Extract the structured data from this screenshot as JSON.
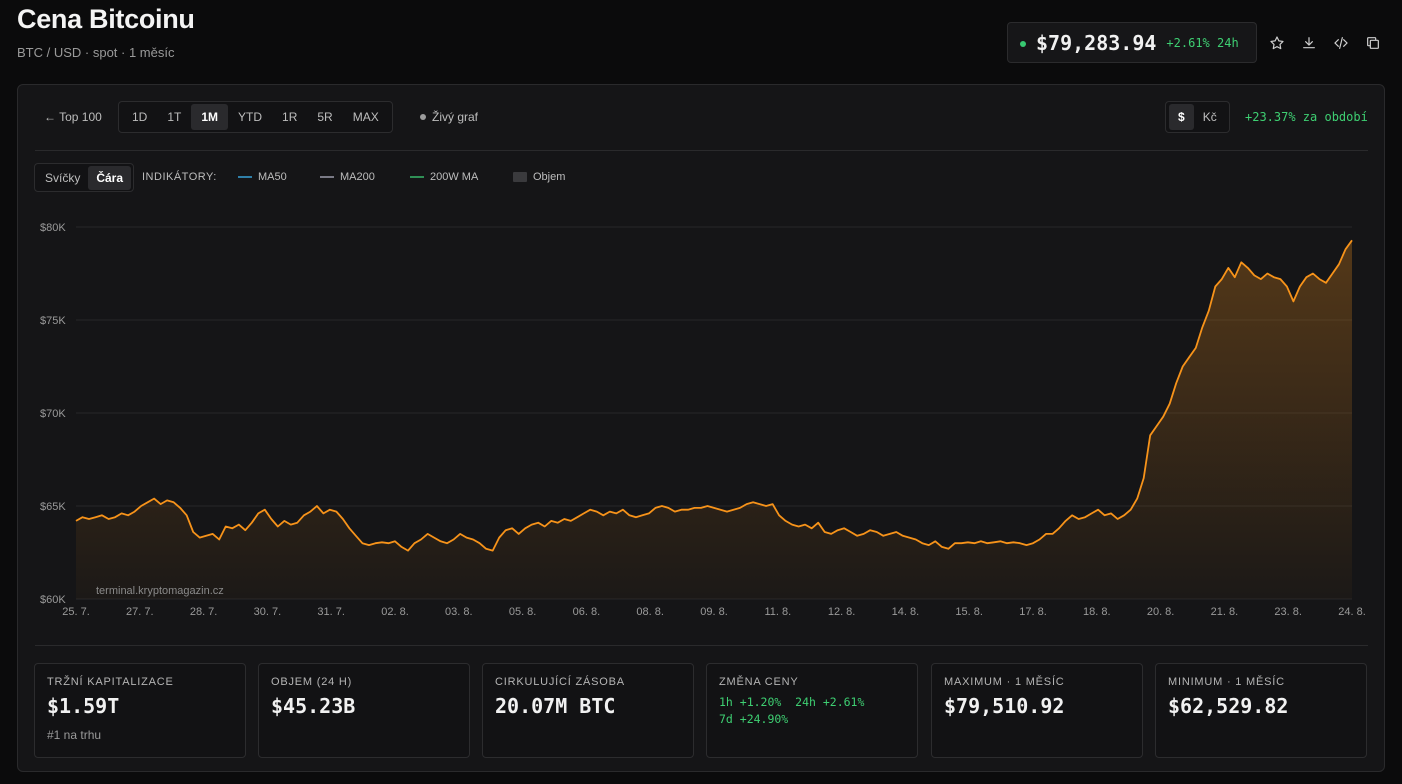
{
  "header": {
    "title": "Cena Bitcoinu",
    "subtitle": "BTC / USD · spot · 1 měsíc",
    "price": "$79,283.94",
    "price_change": "+2.61% 24h"
  },
  "toolbar": {
    "back_label": "← Top 100",
    "ranges": [
      "1D",
      "1T",
      "1M",
      "YTD",
      "1R",
      "5R",
      "MAX"
    ],
    "active_range": "1M",
    "live_chart_label": "Živý graf",
    "currencies": [
      "$",
      "Kč"
    ],
    "active_currency": "$",
    "period_change": "+23.37% za období"
  },
  "chart_controls": {
    "types": [
      "Svíčky",
      "Čára"
    ],
    "active_type": "Čára",
    "indicators_label": "INDIKÁTORY:",
    "indicators": [
      {
        "label": "MA50",
        "color": "#2f7fa8"
      },
      {
        "label": "MA200",
        "color": "#7a7a86"
      },
      {
        "label": "200W MA",
        "color": "#2f8f55"
      },
      {
        "label": "Objem",
        "color": "#3a3a3d"
      }
    ]
  },
  "chart_data": {
    "type": "area",
    "title": "",
    "xlabel": "",
    "ylabel": "",
    "ylim": [
      60000,
      80000
    ],
    "y_ticks": [
      "$80K",
      "$75K",
      "$70K",
      "$65K",
      "$60K"
    ],
    "x_ticks": [
      "25. 7.",
      "27. 7.",
      "28. 7.",
      "30. 7.",
      "31. 7.",
      "02. 8.",
      "03. 8.",
      "05. 8.",
      "06. 8.",
      "08. 8.",
      "09. 8.",
      "11. 8.",
      "12. 8.",
      "14. 8.",
      "15. 8.",
      "17. 8.",
      "18. 8.",
      "20. 8.",
      "21. 8.",
      "23. 8.",
      "24. 8."
    ],
    "line_color": "#f7931a",
    "grid": true,
    "watermark": "terminal.kryptomagazin.cz",
    "series": [
      {
        "values": [
          64200,
          64400,
          64300,
          64400,
          64500,
          64300,
          64400,
          64600,
          64500,
          64700,
          65000,
          65200,
          65400,
          65100,
          65300,
          65200,
          64900,
          64500,
          63600,
          63300,
          63400,
          63500,
          63200,
          63900,
          63800,
          64000,
          63700,
          64100,
          64600,
          64800,
          64300,
          63900,
          64200,
          64000,
          64100,
          64500,
          64700,
          65000,
          64600,
          64800,
          64700,
          64300,
          63800,
          63400,
          63000,
          62900,
          63000,
          63050,
          63000,
          63100,
          62800,
          62600,
          63000,
          63200,
          63500,
          63300,
          63100,
          63000,
          63200,
          63500,
          63300,
          63200,
          63000,
          62700,
          62600,
          63300,
          63700,
          63800,
          63500,
          63800,
          64000,
          64100,
          63900,
          64200,
          64100,
          64300,
          64200,
          64400,
          64600,
          64800,
          64700,
          64500,
          64700,
          64600,
          64800,
          64500,
          64400,
          64500,
          64600,
          64900,
          65000,
          64900,
          64700,
          64800,
          64800,
          64900,
          64900,
          65000,
          64900,
          64800,
          64700,
          64800,
          64900,
          65100,
          65200,
          65100,
          65000,
          65100,
          64500,
          64200,
          64000,
          63900,
          64000,
          63800,
          64100,
          63600,
          63500,
          63700,
          63800,
          63600,
          63400,
          63500,
          63700,
          63600,
          63400,
          63500,
          63600,
          63400,
          63300,
          63200,
          63000,
          62900,
          63100,
          62800,
          62700,
          63000,
          63000,
          63050,
          63000,
          63100,
          63000,
          63050,
          63100,
          63000,
          63050,
          63000,
          62900,
          63000,
          63200,
          63500,
          63500,
          63800,
          64200,
          64500,
          64300,
          64400,
          64600,
          64800,
          64500,
          64600,
          64300,
          64500,
          64800,
          65400,
          66500,
          68800,
          69300,
          69800,
          70500,
          71600,
          72500,
          73000,
          73500,
          74600,
          75500,
          76800,
          77200,
          77800,
          77300,
          78100,
          77800,
          77400,
          77200,
          77500,
          77300,
          77200,
          76800,
          76000,
          76800,
          77300,
          77500,
          77200,
          77000,
          77500,
          78000,
          78800,
          79283.94
        ],
        "dates": [
          "25. 7.",
          "24. 8."
        ]
      }
    ],
    "max": "$79,510.92",
    "min": "$62,529.82"
  },
  "stats": [
    {
      "label": "TRŽNÍ KAPITALIZACE",
      "value": "$1.59T",
      "sub": "#1 na trhu"
    },
    {
      "label": "OBJEM (24 H)",
      "value": "$45.23B",
      "sub": ""
    },
    {
      "label": "CIRKULUJÍCÍ ZÁSOBA",
      "value": "20.07M BTC",
      "sub": ""
    },
    {
      "label": "ZMĚNA CENY",
      "value": "",
      "changes": [
        "1h +1.20%",
        "24h +2.61%",
        "7d +24.90%"
      ]
    },
    {
      "label": "MAXIMUM · 1 MĚSÍC",
      "value": "$79,510.92",
      "sub": ""
    },
    {
      "label": "MINIMUM · 1 MĚSÍC",
      "value": "$62,529.82",
      "sub": ""
    }
  ]
}
